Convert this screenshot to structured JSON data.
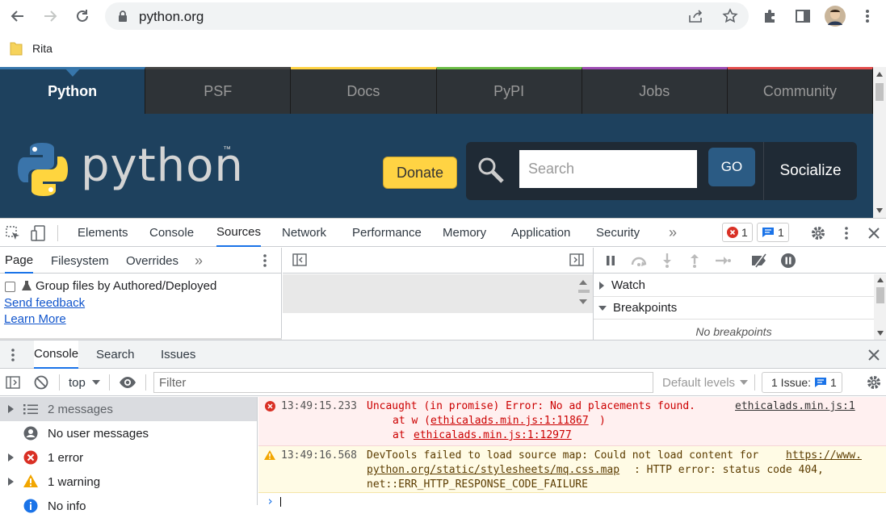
{
  "browser": {
    "url": "python.org",
    "bookmark": "Rita"
  },
  "site": {
    "nav": [
      "Python",
      "PSF",
      "Docs",
      "PyPI",
      "Jobs",
      "Community"
    ],
    "nav_colors": [
      "#3776ab",
      "#444444",
      "#ffd343",
      "#6bbd45",
      "#9e4cb4",
      "#e44d4d"
    ],
    "logo_text": "python",
    "tm": "™",
    "donate": "Donate",
    "search_placeholder": "Search",
    "go": "GO",
    "socialize": "Socialize"
  },
  "devtools": {
    "tabs": [
      "Elements",
      "Console",
      "Sources",
      "Network",
      "Performance",
      "Memory",
      "Application",
      "Security"
    ],
    "more": "»",
    "error_count": "1",
    "message_count": "1",
    "nav_tabs": [
      "Page",
      "Filesystem",
      "Overrides"
    ],
    "group_files": "Group files by Authored/Deployed",
    "send_feedback": "Send feedback",
    "learn_more": "Learn More",
    "watch": "Watch",
    "breakpoints": "Breakpoints",
    "no_breakpoints": "No breakpoints"
  },
  "drawer": {
    "tabs": [
      "Console",
      "Search",
      "Issues"
    ],
    "context": "top",
    "filter_placeholder": "Filter",
    "levels": "Default levels",
    "issues_label": "1 Issue:",
    "issues_count": "1",
    "sidebar": [
      "2 messages",
      "No user messages",
      "1 error",
      "1 warning",
      "No info"
    ],
    "messages": {
      "error": {
        "time": "13:49:15.233",
        "text": "Uncaught (in promise) Error: No ad placements found.",
        "source": "ethicalads.min.js:1",
        "stack1_prefix": "at w (",
        "stack1_link": "ethicalads.min.js:1:11867",
        "stack1_suffix": ")",
        "stack2_prefix": "at ",
        "stack2_link": "ethicalads.min.js:1:12977"
      },
      "warning": {
        "time": "13:49:16.568",
        "text": "DevTools failed to load source map: Could not load content for ",
        "link1": "https://www.",
        "link2": "python.org/static/stylesheets/mq.css.map",
        "text2": ": HTTP error: status code 404,",
        "text3": "net::ERR_HTTP_RESPONSE_CODE_FAILURE"
      }
    },
    "prompt": "›"
  }
}
